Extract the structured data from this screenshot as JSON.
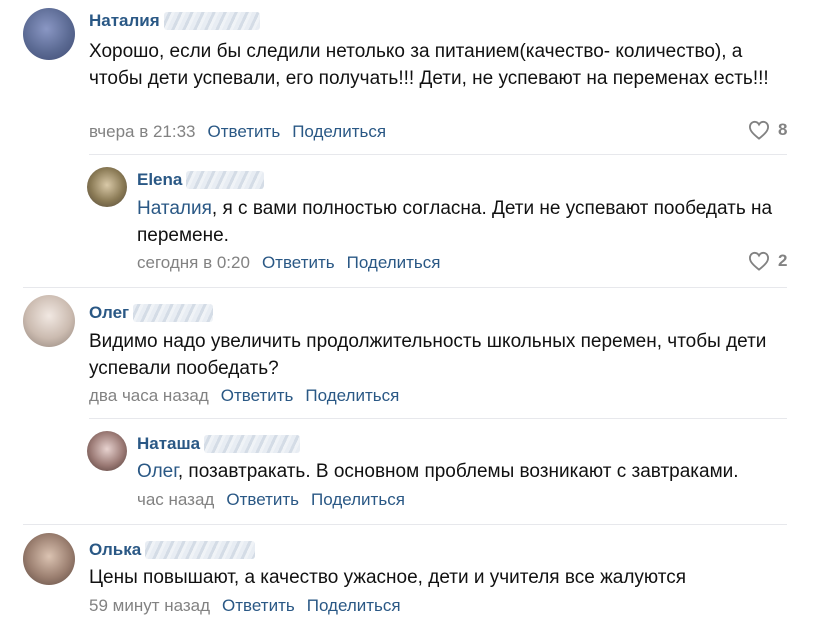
{
  "actions": {
    "reply": "Ответить",
    "share": "Поделиться"
  },
  "comments": [
    {
      "author": "Наталия",
      "text": "Хорошо, если бы следили нетолько за питанием(качество- количество), а чтобы дети успевали, его получать!!! Дети, не успевают на переменах есть!!!",
      "time": "вчера в 21:33",
      "likes": "8",
      "avatar_color": "#5b6a93"
    },
    {
      "author": "Elena",
      "mention": "Наталия",
      "text": ", я с вами полностью согласна. Дети не успевают пообедать на перемене.",
      "time": "сегодня в 0:20",
      "likes": "2",
      "avatar_color": "#8a7a55"
    },
    {
      "author": "Олег",
      "text": "Видимо надо увеличить продолжительность школьных перемен, чтобы дети успевали пообедать?",
      "time": "два часа назад",
      "avatar_color": "#cbbbb0"
    },
    {
      "author": "Наташа",
      "mention": "Олег",
      "text": ", позавтракать. В основном проблемы возникают с завтраками.",
      "time": "час назад",
      "avatar_color": "#7a5a55"
    },
    {
      "author": "Олька",
      "text": "Цены повышают, а качество ужасное, дети и учителя все жалуются",
      "time": "59 минут назад",
      "avatar_color": "#9b7f70"
    }
  ]
}
